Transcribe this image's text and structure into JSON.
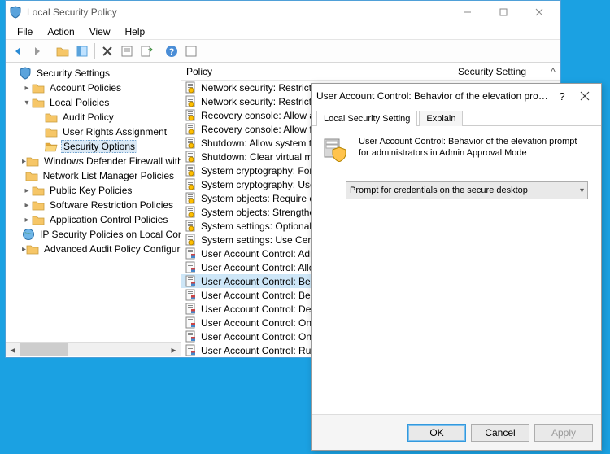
{
  "main_window": {
    "title": "Local Security Policy",
    "menus": [
      "File",
      "Action",
      "View",
      "Help"
    ],
    "tree": {
      "root": "Security Settings",
      "items": [
        {
          "label": "Account Policies",
          "level": 1,
          "arrow": ">"
        },
        {
          "label": "Local Policies",
          "level": 1,
          "arrow": "v"
        },
        {
          "label": "Audit Policy",
          "level": 2,
          "arrow": ""
        },
        {
          "label": "User Rights Assignment",
          "level": 2,
          "arrow": ""
        },
        {
          "label": "Security Options",
          "level": 2,
          "arrow": "",
          "selected": true
        },
        {
          "label": "Windows Defender Firewall with Advanced Security",
          "level": 1,
          "arrow": ">"
        },
        {
          "label": "Network List Manager Policies",
          "level": 1,
          "arrow": ""
        },
        {
          "label": "Public Key Policies",
          "level": 1,
          "arrow": ">"
        },
        {
          "label": "Software Restriction Policies",
          "level": 1,
          "arrow": ">"
        },
        {
          "label": "Application Control Policies",
          "level": 1,
          "arrow": ">"
        },
        {
          "label": "IP Security Policies on Local Computer",
          "level": 1,
          "arrow": "",
          "sp": true
        },
        {
          "label": "Advanced Audit Policy Configuration",
          "level": 1,
          "arrow": ">"
        }
      ]
    },
    "list": {
      "header_policy": "Policy",
      "header_setting": "Security Setting",
      "rows": [
        "Network security: Restrict NTL",
        "Network security: Restrict NTL",
        "Recovery console: Allow auto",
        "Recovery console: Allow flopp",
        "Shutdown: Allow system to be",
        "Shutdown: Clear virtual mem",
        "System cryptography: Force s",
        "System cryptography: Use FIP",
        "System objects: Require case i",
        "System objects: Strengthen de",
        "System settings: Optional sub",
        "System settings: Use Certifica",
        "User Account Control: Admin",
        "User Account Control: Allow U",
        "User Account Control: Behavi",
        "User Account Control: Behavi",
        "User Account Control: Detect",
        "User Account Control: Only el",
        "User Account Control: Only el",
        "User Account Control: Run all"
      ],
      "selected_index": 14
    }
  },
  "dialog": {
    "title": "User Account Control: Behavior of the elevation prompt f...",
    "tabs": [
      "Local Security Setting",
      "Explain"
    ],
    "policy_name": "User Account Control: Behavior of the elevation prompt for administrators in Admin Approval Mode",
    "dropdown_value": "Prompt for credentials on the secure desktop",
    "buttons": {
      "ok": "OK",
      "cancel": "Cancel",
      "apply": "Apply"
    }
  }
}
